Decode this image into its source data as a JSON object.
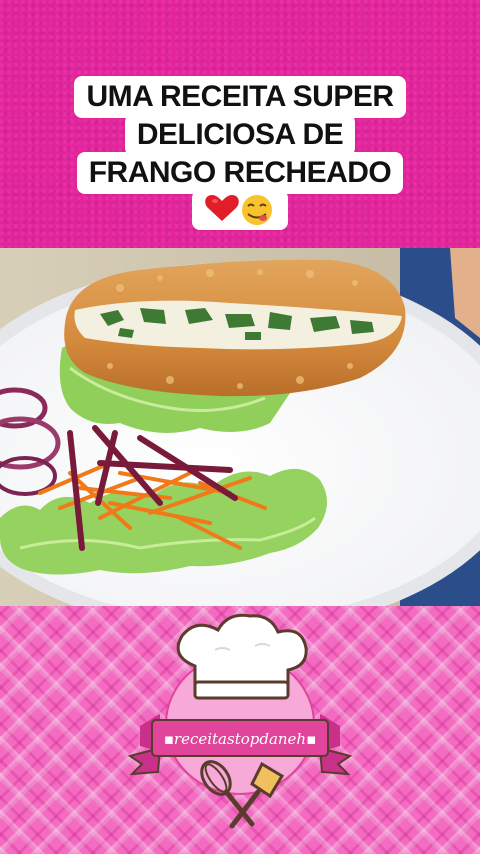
{
  "title": {
    "lines": [
      "UMA RECEITA SUPER",
      "DELICIOSA DE",
      "FRANGO RECHEADO"
    ],
    "emoji": "❤️😋"
  },
  "logo": {
    "text": "▪receitastopdaneh▪"
  },
  "colors": {
    "top_background": "#e3249d",
    "plaid_background": "#f36cc2",
    "logo_banner": "#e0459b"
  },
  "icons": [
    "heart-emoji",
    "yum-emoji",
    "chef-hat-icon",
    "whisk-icon",
    "spatula-icon"
  ]
}
